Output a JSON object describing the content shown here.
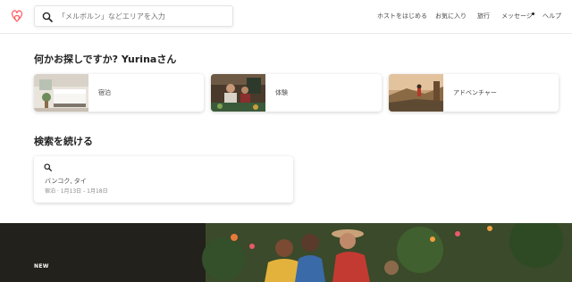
{
  "header": {
    "search_placeholder": "「メルボルン」などエリアを入力",
    "nav": {
      "host": "ホストをはじめる",
      "saved": "お気に入り",
      "trips": "旅行",
      "messages": "メッセージ",
      "help": "ヘルプ"
    },
    "brand_color": "#FF5A5F"
  },
  "explore": {
    "title": "何かお探しですか? Yurinaさん",
    "cards": [
      {
        "label": "宿泊",
        "icon": "room-photo"
      },
      {
        "label": "体験",
        "icon": "cooking-photo"
      },
      {
        "label": "アドベンチャー",
        "icon": "hiking-photo"
      }
    ]
  },
  "continue_search": {
    "title": "検索を続ける",
    "item": {
      "place": "バンコク, タイ",
      "dates": "宿泊 · 1月13日 - 1月18日"
    }
  },
  "hero": {
    "badge": "NEW"
  }
}
